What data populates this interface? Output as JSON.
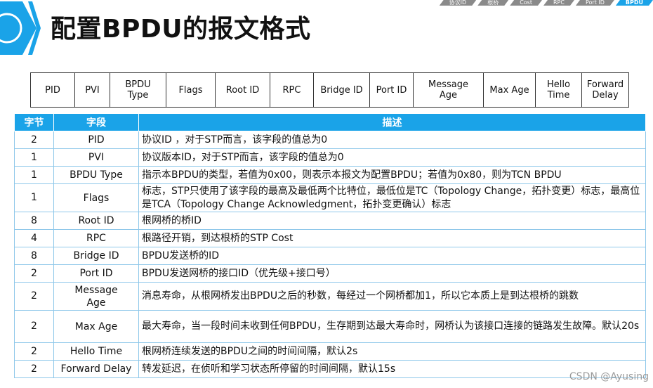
{
  "breadcrumb": [
    {
      "label": "协议ID",
      "active": false
    },
    {
      "label": "根桥",
      "active": false
    },
    {
      "label": "Cost",
      "active": false
    },
    {
      "label": "RPC",
      "active": false
    },
    {
      "label": "Port ID",
      "active": false
    },
    {
      "label": "BPDU",
      "active": true
    }
  ],
  "title": "配置BPDU的报文格式",
  "format_fields": [
    {
      "label": "PID",
      "w": 62
    },
    {
      "label": "PVI",
      "w": 50
    },
    {
      "label": "BPDU\nType",
      "w": 80
    },
    {
      "label": "Flags",
      "w": 70
    },
    {
      "label": "Root ID",
      "w": 78
    },
    {
      "label": "RPC",
      "w": 62
    },
    {
      "label": "Bridge ID",
      "w": 80
    },
    {
      "label": "Port ID",
      "w": 62
    },
    {
      "label": "Message\nAge",
      "w": 100
    },
    {
      "label": "Max Age",
      "w": 74
    },
    {
      "label": "Hello\nTime",
      "w": 66
    },
    {
      "label": "Forward\nDelay",
      "w": 67
    }
  ],
  "table": {
    "headers": [
      "字节",
      "字段",
      "描述"
    ],
    "rows": [
      {
        "bytes": "2",
        "field": "PID",
        "desc": "协议ID ，对于STP而言，该字段的值总为0",
        "h": 25
      },
      {
        "bytes": "1",
        "field": "PVI",
        "desc": "协议版本ID，对于STP而言，该字段的值总为0",
        "h": 25
      },
      {
        "bytes": "1",
        "field": "BPDU Type",
        "desc": "指示本BPDU的类型，若值为0x00，则表示本报文为配置BPDU；若值为0x80，则为TCN BPDU",
        "h": 25
      },
      {
        "bytes": "1",
        "field": "Flags",
        "desc": "标志，STP只使用了该字段的最高及最低两个比特位，最低位是TC（Topology Change，拓扑变更）标志，最高位是TCA（Topology Change Acknowledgment，拓扑变更确认）标志",
        "h": 40
      },
      {
        "bytes": "8",
        "field": "Root ID",
        "desc": "根网桥的桥ID",
        "h": 25
      },
      {
        "bytes": "4",
        "field": "RPC",
        "desc": "根路径开销，到达根桥的STP Cost",
        "h": 25
      },
      {
        "bytes": "8",
        "field": "Bridge ID",
        "desc": "BPDU发送桥的ID",
        "h": 25
      },
      {
        "bytes": "2",
        "field": "Port ID",
        "desc": "BPDU发送网桥的接口ID（优先级+接口号）",
        "h": 25
      },
      {
        "bytes": "2",
        "field": "Message\nAge",
        "desc": "消息寿命，从根网桥发出BPDU之后的秒数，每经过一个网桥都加1，所以它本质上是到达根桥的跳数",
        "h": 40
      },
      {
        "bytes": "2",
        "field": "Max Age",
        "desc": "最大寿命，当一段时间未收到任何BPDU，生存期到达最大寿命时，网桥认为该接口连接的链路发生故障。默认20s",
        "h": 46
      },
      {
        "bytes": "2",
        "field": "Hello Time",
        "desc": "根网桥连续发送的BPDU之间的时间间隔，默认2s",
        "h": 25
      },
      {
        "bytes": "2",
        "field": "Forward Delay",
        "desc": "转发延迟，在侦听和学习状态所停留的时间间隔，默认15s",
        "h": 25
      }
    ]
  },
  "watermark": "CSDN @Ayusing",
  "colors": {
    "accent": "#1aa3e8",
    "border": "#8fc8ea",
    "logo": "#1aa3e8"
  }
}
